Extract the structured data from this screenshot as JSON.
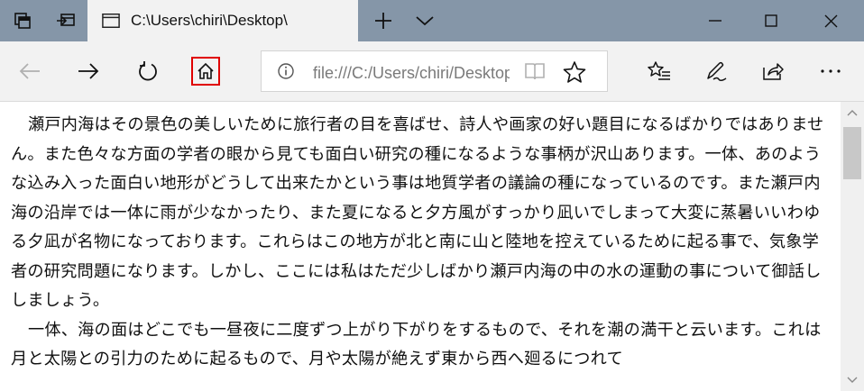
{
  "tab": {
    "title": "C:\\Users\\chiri\\Desktop\\"
  },
  "address": {
    "value": "file:///C:/Users/chiri/Desktop/"
  },
  "content": {
    "paragraphs": [
      "瀬戸内海はその景色の美しいために旅行者の目を喜ばせ、詩人や画家の好い題目になるばかりではありません。また色々な方面の学者の眼から見ても面白い研究の種になるような事柄が沢山あります。一体、あのような込み入った面白い地形がどうして出来たかという事は地質学者の議論の種になっているのです。また瀬戸内海の沿岸では一体に雨が少なかったり、また夏になると夕方風がすっかり凪いでしまって大変に蒸暑いいわゆる夕凪が名物になっております。これらはこの地方が北と南に山と陸地を控えているために起る事で、気象学者の研究問題になります。しかし、ここには私はただ少しばかり瀬戸内海の中の水の運動の事について御話ししましょう。",
      "一体、海の面はどこでも一昼夜に二度ずつ上がり下がりをするもので、それを潮の満干と云います。これは月と太陽との引力のために起るもので、月や太陽が絶えず東から西へ廻るにつれて"
    ]
  },
  "icons": {
    "set-aside-tabs": "set-aside-tabs-icon",
    "show-set-aside": "show-set-aside-icon",
    "page": "page-icon",
    "new-tab": "plus-icon",
    "tab-preview": "chevron-down-icon",
    "minimize": "minimize-icon",
    "maximize": "maximize-icon",
    "close": "close-icon",
    "back": "back-arrow-icon",
    "forward": "forward-arrow-icon",
    "refresh": "refresh-icon",
    "home": "home-icon",
    "info": "info-icon",
    "reading-view": "book-icon",
    "favorite": "star-icon",
    "favorites-hub": "favorites-list-icon",
    "notes": "pen-icon",
    "share": "share-icon",
    "more": "ellipsis-icon"
  },
  "colors": {
    "titlebar": "#8596a8",
    "toolbar": "#f2f2f2",
    "home_highlight": "#e00000"
  }
}
